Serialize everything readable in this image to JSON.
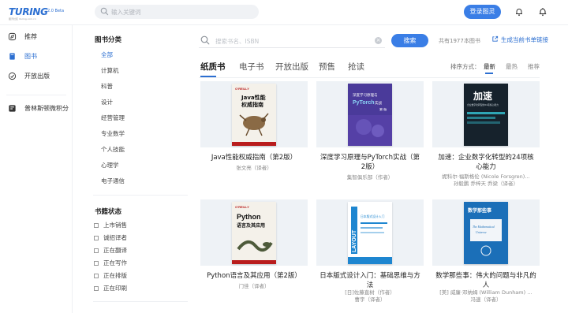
{
  "brand": {
    "name": "TURING",
    "subtitle": "图灵社区 ituring.com.cn",
    "version": "2.0 Beta"
  },
  "topbar": {
    "search_placeholder": "输入关键词",
    "login_label": "登录图灵"
  },
  "leftnav": {
    "items": [
      {
        "label": "推荐",
        "icon": "compass-icon"
      },
      {
        "label": "图书",
        "icon": "book-icon"
      },
      {
        "label": "开放出版",
        "icon": "open-publish-icon"
      },
      {
        "label": "普林斯顿微积分",
        "icon": "course-icon"
      }
    ],
    "active_index": 1
  },
  "filters": {
    "category_heading": "图书分类",
    "categories": [
      "全部",
      "计算机",
      "科普",
      "设计",
      "经营管理",
      "专业数学",
      "个人技能",
      "心理学",
      "电子通信"
    ],
    "active_category": 0,
    "status_heading": "书籍状态",
    "statuses": [
      "上市销售",
      "诚招译者",
      "正在翻译",
      "正在写作",
      "正在排版",
      "正在印刷"
    ]
  },
  "main": {
    "search_placeholder": "搜索书名、ISBN",
    "search_button": "搜索",
    "total_count": "共有1977本图书",
    "generate_link": "生成当前书单链接",
    "tabs": [
      "纸质书",
      "电子书",
      "开放出版",
      "预售",
      "抢读"
    ],
    "active_tab": 0,
    "sort_label": "排序方式：",
    "sort_options": [
      "最新",
      "最热",
      "推荐"
    ],
    "active_sort": 0
  },
  "books": [
    {
      "title": "Java性能权威指南（第2版）",
      "authors": [
        "张文亮（译者）"
      ],
      "cover": {
        "bg": "#f4f1ea",
        "text": "Java性能\n权威指南",
        "sub": "Java Performance",
        "publisher": "O'REILLY",
        "accent": "#b91d1d"
      }
    },
    {
      "title": "深度学习原理与PyTorch实战（第2版）",
      "authors": [
        "集智俱乐部（作者）"
      ],
      "cover": {
        "bg": "#5540a6",
        "text": "深度学习原理与\nPyTorch实战",
        "sub": "第2版",
        "accent": "#8bd3f5"
      }
    },
    {
      "title": "加速：企业数字化转型的24项核心能力",
      "authors": [
        "妮科尔·福斯格伦 (Nicole Forsgren)…",
        "孙毅鹏 乔梓天 乔梁（译者）"
      ],
      "cover": {
        "bg": "#16222c",
        "text": "加速",
        "sub": "企业数字化转型的24项核心能力",
        "accent": "#2fa6b5"
      }
    },
    {
      "title": "Python语言及其应用（第2版）",
      "authors": [
        "门佳（译者）"
      ],
      "cover": {
        "bg": "#f4f1ea",
        "text": "Python\n语言及其应用",
        "sub": "Introducing Python",
        "publisher": "O'REILLY",
        "accent": "#b91d1d"
      }
    },
    {
      "title": "日本版式设计入门：基础思维与方法",
      "authors": [
        "[日]佐藤直树（作者）",
        "曹宇（译者）"
      ],
      "cover": {
        "bg": "#ffffff",
        "text": "LAYOUT",
        "sub": "日本版式设计入门",
        "accent": "#1e86d0"
      }
    },
    {
      "title": "数学那些事：伟大的问题与非凡的人",
      "authors": [
        "[美] 威廉·邓纳姆 (William Dunham) …",
        "冯速（译者）"
      ],
      "cover": {
        "bg": "#1b6fb8",
        "text": "数学那些事",
        "sub": "The Mathematical Universe",
        "accent": "#f2f5f9"
      }
    }
  ]
}
